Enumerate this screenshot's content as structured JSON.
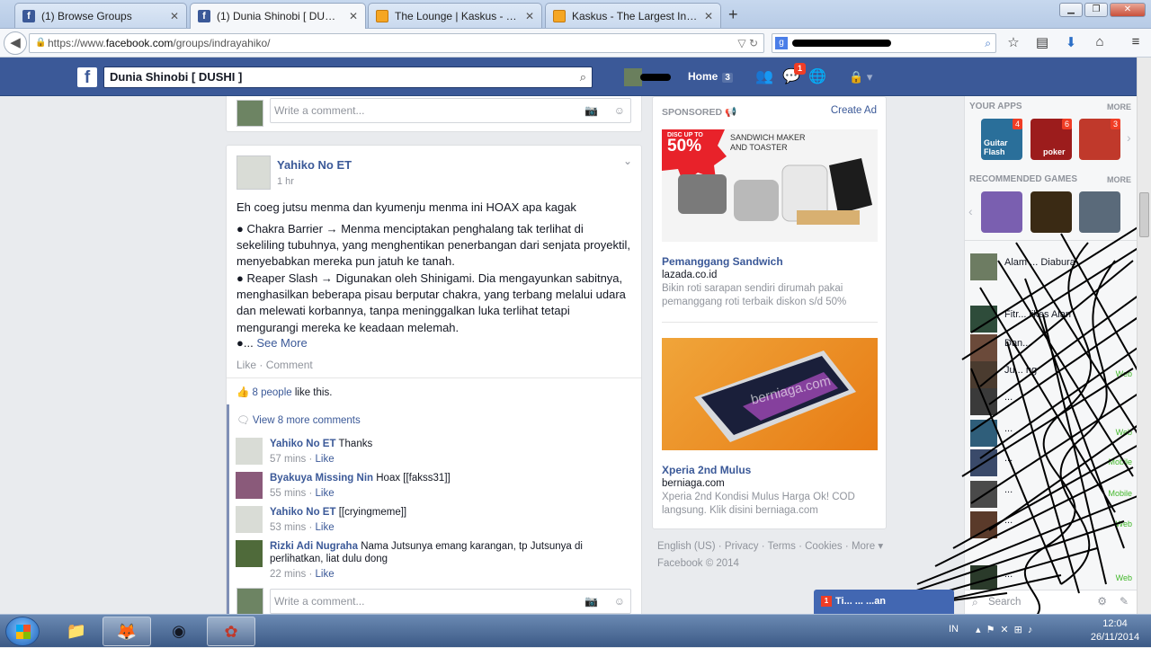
{
  "browser": {
    "tabs": [
      {
        "title": "(1) Browse Groups",
        "icon": "facebook-icon"
      },
      {
        "title": "(1) Dunia Shinobi [ DUSHI ]",
        "icon": "facebook-icon",
        "active": true
      },
      {
        "title": "The Lounge | Kaskus - The ...",
        "icon": "kaskus-icon"
      },
      {
        "title": "Kaskus - The Largest Indon...",
        "icon": "kaskus-icon"
      }
    ],
    "new_tab": "+",
    "url_prefix": "https://www.",
    "url_domain": "facebook.com",
    "url_path": "/groups/indrayahiko/",
    "search_engine_letter": "g"
  },
  "fb": {
    "logo": "f",
    "search_value": "Dunia Shinobi [ DUSHI ]",
    "home_label": "Home",
    "home_count": "3",
    "messages_badge": "1"
  },
  "top_comment_placeholder": "Write a comment...",
  "post": {
    "author": "Yahiko No ET",
    "time": "1 hr",
    "text_line1": "Eh coeg jutsu menma dan kyumenju menma ini HOAX apa kagak",
    "para1": "● Chakra Barrier → Menma menciptakan penghalang tak terlihat di sekeliling tubuhnya, yang menghentikan penerbangan dari senjata proyektil, menyebabkan mereka pun jatuh ke tanah.",
    "para2": "● Reaper Slash → Digunakan oleh Shinigami. Dia mengayunkan sabitnya, menghasilkan beberapa pisau berputar chakra, yang terbang melalui udara dan melewati korbannya, tanpa meninggalkan luka terlihat tetapi mengurangi mereka ke keadaan melemah.",
    "para3_prefix": "●...",
    "see_more": "See More",
    "like": "Like",
    "comment": "Comment",
    "separator": "·",
    "likes_count": "8 people",
    "likes_suffix": "like this.",
    "view_more": "View 8 more comments",
    "comments": [
      {
        "name": "Yahiko No ET",
        "text": "Thanks",
        "time": "57 mins",
        "action": "Like"
      },
      {
        "name": "Byakuya Missing Nin",
        "text": "Hoax [[fakss31]]",
        "time": "55 mins",
        "action": "Like"
      },
      {
        "name": "Yahiko No ET",
        "text": "[[cryingmeme]]",
        "time": "53 mins",
        "action": "Like"
      },
      {
        "name": "Rizki Adi Nugraha",
        "text": "Nama Jutsunya emang karangan, tp Jutsunya di perlihatkan, liat dulu dong",
        "time": "22 mins",
        "action": "Like"
      }
    ],
    "write_comment": "Write a comment..."
  },
  "ads": {
    "sponsored": "SPONSORED",
    "create_ad": "Create Ad",
    "items": [
      {
        "title": "Pemanggang Sandwich",
        "domain": "lazada.co.id",
        "desc": "Bikin roti sarapan sendiri dirumah pakai pemanggang roti terbaik diskon s/d 50%",
        "img_badge_top": "DISC UP TO",
        "img_badge": "50%",
        "img_caption_1": "SANDWICH MAKER",
        "img_caption_2": "AND TOASTER"
      },
      {
        "title": "Xperia 2nd Mulus",
        "domain": "berniaga.com",
        "desc": "Xperia 2nd Kondisi Mulus Harga Ok! COD langsung. Klik disini berniaga.com",
        "img_watermark": "berniaga.com"
      }
    ]
  },
  "footer": {
    "links": [
      "English (US)",
      "Privacy",
      "Terms",
      "Cookies",
      "More"
    ],
    "sep": "·",
    "copyright": "Facebook © 2014"
  },
  "sidebar": {
    "your_apps": "YOUR APPS",
    "more": "MORE",
    "apps": [
      {
        "badge": "4",
        "label": "Guitar Flash",
        "color": "#2a6f9a"
      },
      {
        "badge": "6",
        "label": "poker",
        "color": "#9c1c1c"
      },
      {
        "badge": "3",
        "label": "",
        "color": "#c0392b"
      }
    ],
    "recommended": "RECOMMENDED GAMES",
    "games": [
      {
        "color": "#7a5fb0"
      },
      {
        "color": "#3a2a14"
      },
      {
        "color": "#5a6a7a"
      }
    ],
    "friends": [
      {
        "name": "Alam ... Diabura",
        "status": ""
      },
      {
        "name": "Fitr... likes Alan",
        "status": ""
      },
      {
        "name": "Dan...",
        "status": ""
      },
      {
        "name": "Ju... ng",
        "status": "Web"
      },
      {
        "name": "...",
        "status": ""
      },
      {
        "name": "...",
        "status": "Web"
      },
      {
        "name": "...",
        "status": "Mobile"
      },
      {
        "name": "...",
        "status": "Mobile"
      },
      {
        "name": "...",
        "status": "Web"
      },
      {
        "name": "...",
        "status": "Web"
      }
    ],
    "search_placeholder": "Search"
  },
  "chat": {
    "label": "Ti... ... ...an",
    "badge": "1"
  },
  "taskbar": {
    "lang": "IN",
    "time": "12:04",
    "date": "26/11/2014"
  }
}
